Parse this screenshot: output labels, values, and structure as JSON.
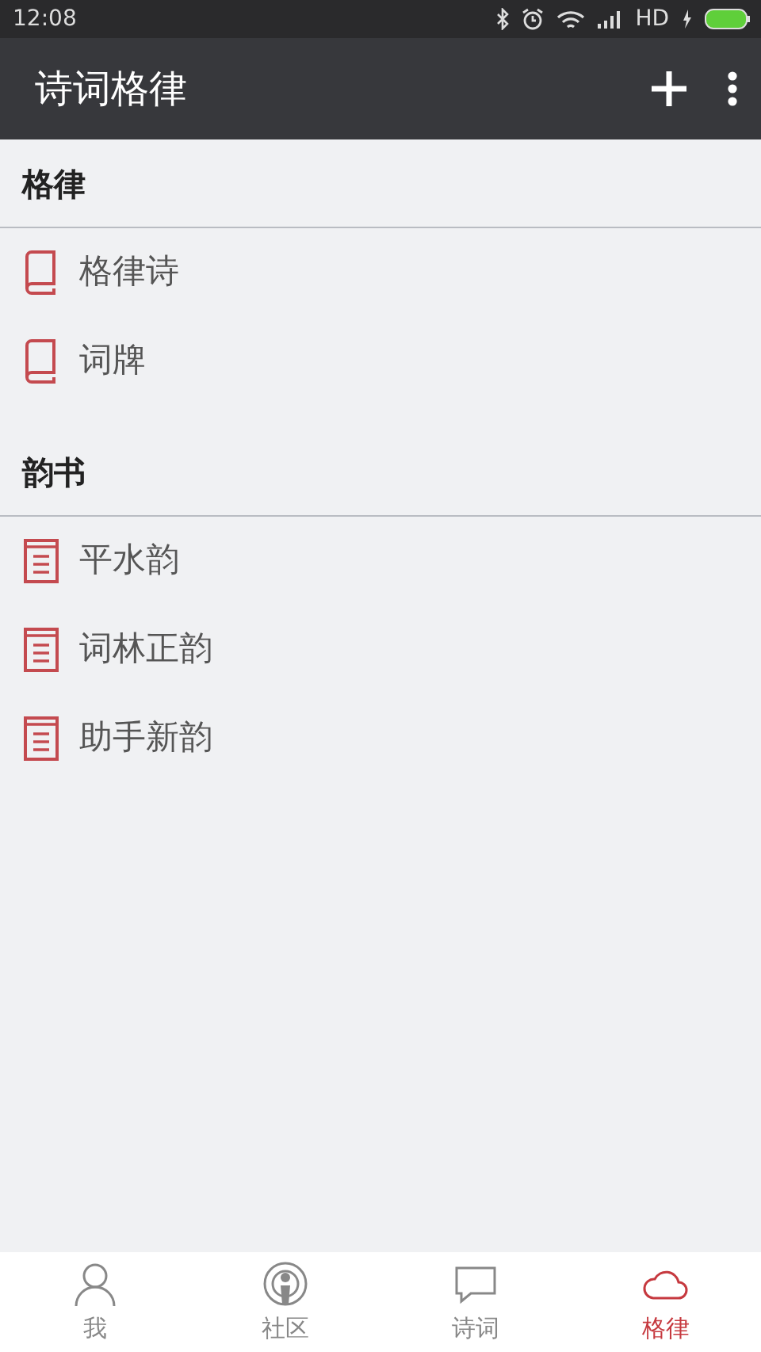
{
  "status_bar": {
    "time": "12:08",
    "network": "HD"
  },
  "app_bar": {
    "title": "诗词格律"
  },
  "sections": [
    {
      "title": "格律",
      "items": [
        {
          "label": "格律诗",
          "kind": "book"
        },
        {
          "label": "词牌",
          "kind": "book"
        }
      ]
    },
    {
      "title": "韵书",
      "items": [
        {
          "label": "平水韵",
          "kind": "doc"
        },
        {
          "label": "词林正韵",
          "kind": "doc"
        },
        {
          "label": "助手新韵",
          "kind": "doc"
        }
      ]
    }
  ],
  "bottom_nav": [
    {
      "label": "我",
      "kind": "person",
      "selected": false
    },
    {
      "label": "社区",
      "kind": "broadcast",
      "selected": false
    },
    {
      "label": "诗词",
      "kind": "chat",
      "selected": false
    },
    {
      "label": "格律",
      "kind": "rules",
      "selected": true
    }
  ]
}
